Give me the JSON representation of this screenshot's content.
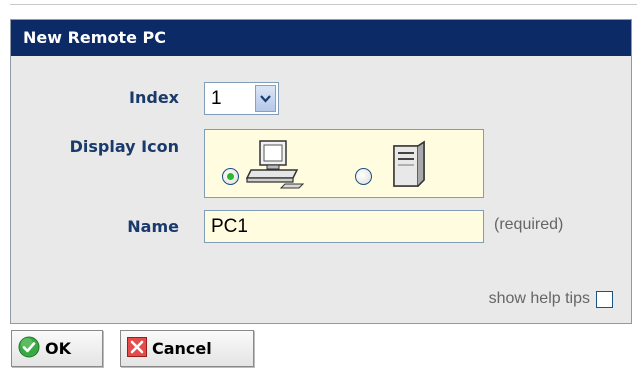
{
  "dialog": {
    "title": "New Remote PC"
  },
  "form": {
    "index_label": "Index",
    "index_value": "1",
    "display_icon_label": "Display Icon",
    "icon_options": [
      {
        "icon": "desktop-pc-icon",
        "selected": true
      },
      {
        "icon": "server-tower-icon",
        "selected": false
      }
    ],
    "name_label": "Name",
    "name_value": "PC1",
    "name_hint": "(required)"
  },
  "help": {
    "label": "show help tips",
    "checked": false
  },
  "buttons": {
    "ok_label": "OK",
    "cancel_label": "Cancel"
  },
  "colors": {
    "title_bar": "#0b2a66",
    "label_text": "#1a3a6b",
    "panel_bg": "#e9e9e9",
    "field_bg": "#fffce0",
    "ok_icon": "#2e9e36",
    "cancel_icon": "#d42a2a"
  }
}
